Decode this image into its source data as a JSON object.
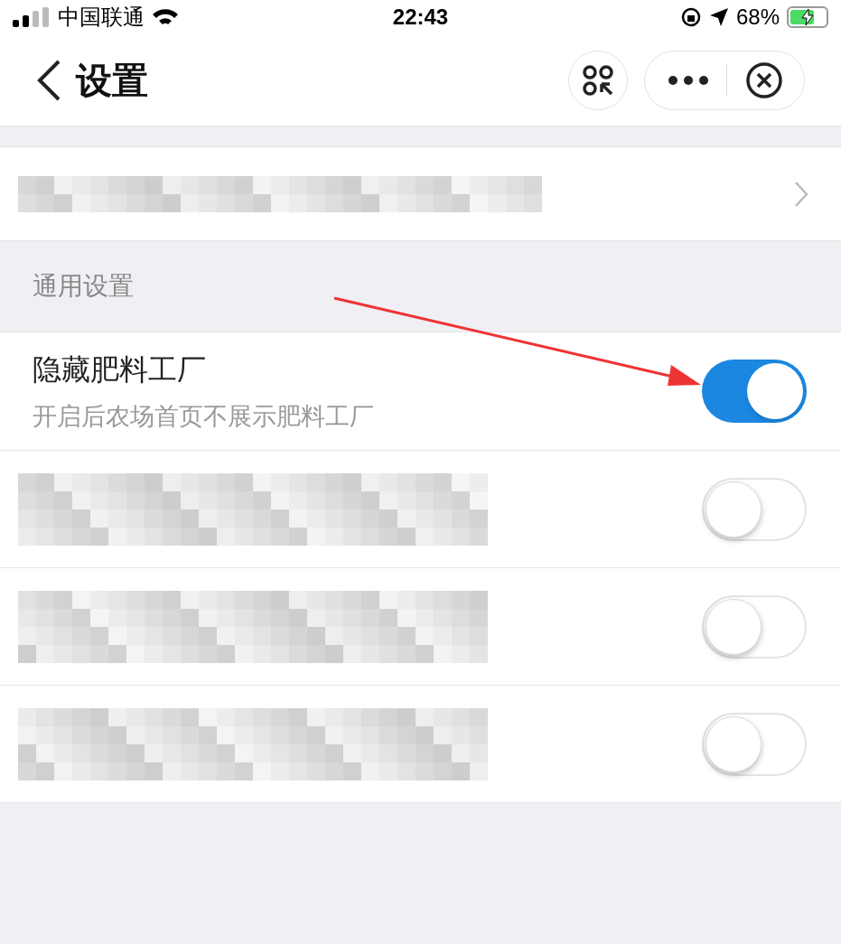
{
  "status_bar": {
    "carrier": "中国联通",
    "time": "22:43",
    "battery": "68%",
    "charging": true
  },
  "nav": {
    "title": "设置"
  },
  "account_row": {
    "redacted": true
  },
  "section": {
    "title": "通用设置"
  },
  "settings": [
    {
      "kind": "plain",
      "title": "隐藏肥料工厂",
      "subtitle": "开启后农场首页不展示肥料工厂",
      "on": true
    },
    {
      "kind": "redacted",
      "on": false
    },
    {
      "kind": "redacted",
      "on": false
    },
    {
      "kind": "redacted",
      "on": false
    }
  ],
  "annotation": {
    "kind": "arrow"
  }
}
